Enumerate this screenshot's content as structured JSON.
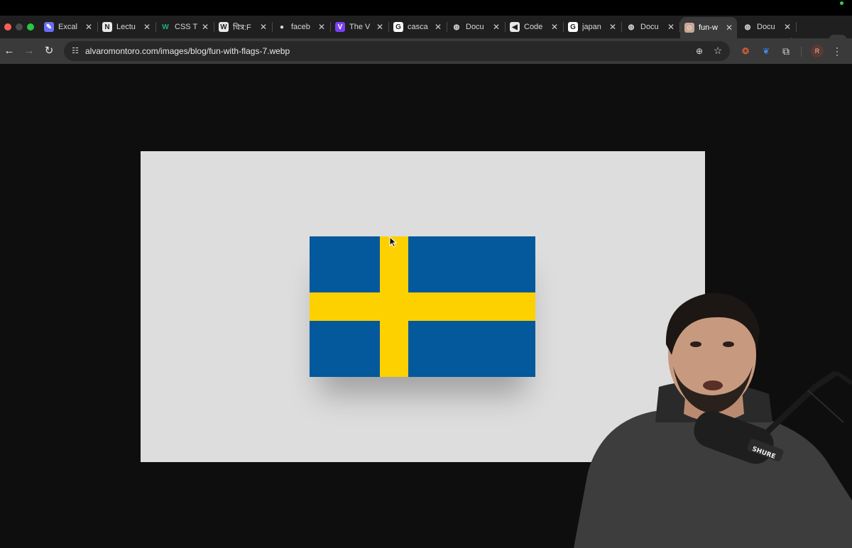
{
  "browser": {
    "tabs": [
      {
        "title": "Excal",
        "icon": "excalidraw-icon",
        "fav_color": "#6b6cf6",
        "glyph": "✎"
      },
      {
        "title": "Lectu",
        "icon": "notion-icon",
        "fav_color": "#e8e8e8",
        "glyph": "N"
      },
      {
        "title": "CSS T",
        "icon": "w-logo-icon",
        "fav_color": "#1f1f1f",
        "glyph": "W"
      },
      {
        "title": "चित्र:F",
        "icon": "wikipedia-icon",
        "fav_color": "#e8e8e8",
        "glyph": "W"
      },
      {
        "title": "faceb",
        "icon": "github-icon",
        "fav_color": "#1f1f1f",
        "glyph": "●"
      },
      {
        "title": "The V",
        "icon": "vite-icon",
        "fav_color": "#7b3ff2",
        "glyph": "V"
      },
      {
        "title": "casca",
        "icon": "google-icon",
        "fav_color": "#ffffff",
        "glyph": "G"
      },
      {
        "title": "Docu",
        "icon": "globe-icon",
        "fav_color": "#1f1f1f",
        "glyph": "◍"
      },
      {
        "title": "Code",
        "icon": "codepen-icon",
        "fav_color": "#e8e8e8",
        "glyph": "◀"
      },
      {
        "title": "japan",
        "icon": "google-icon",
        "fav_color": "#ffffff",
        "glyph": "G"
      },
      {
        "title": "Docu",
        "icon": "globe-icon",
        "fav_color": "#1f1f1f",
        "glyph": "◍"
      },
      {
        "title": "fun-w",
        "icon": "profile-avatar-icon",
        "fav_color": "#c9a896",
        "glyph": "☺",
        "active": true
      },
      {
        "title": "Docu",
        "icon": "globe-icon",
        "fav_color": "#1f1f1f",
        "glyph": "◍"
      }
    ],
    "new_tab_glyph": "+",
    "tab_search_glyph": "⌄",
    "close_glyph": "✕",
    "url": "alvaromontoro.com/images/blog/fun-with-flags-7.webp",
    "profile_initial": "R"
  },
  "colors": {
    "flag_blue": "#04589c",
    "flag_yellow": "#fdd000",
    "canvas_bg": "#dddddd",
    "page_bg": "#0e0e0e"
  }
}
